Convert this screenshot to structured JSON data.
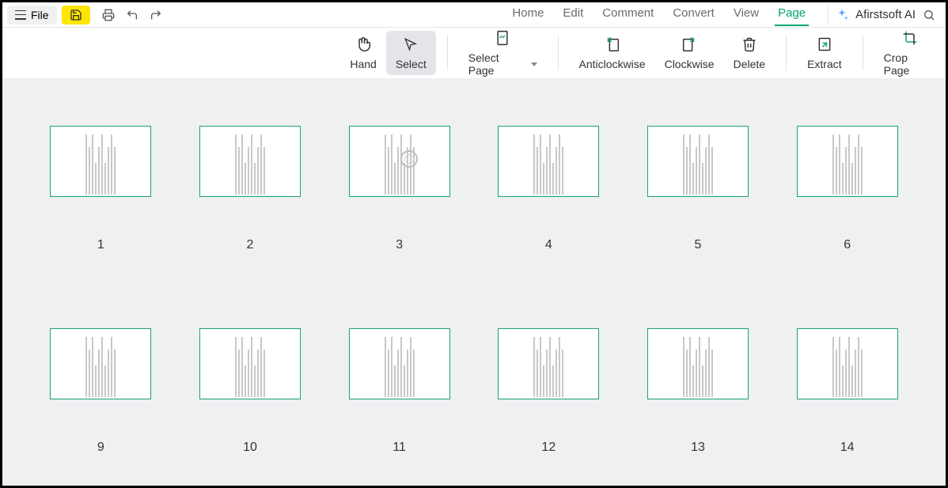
{
  "topbar": {
    "file_label": "File",
    "tabs": [
      {
        "label": "Home",
        "active": false
      },
      {
        "label": "Edit",
        "active": false
      },
      {
        "label": "Comment",
        "active": false
      },
      {
        "label": "Convert",
        "active": false
      },
      {
        "label": "View",
        "active": false
      },
      {
        "label": "Page",
        "active": true
      }
    ],
    "ai_label": "Afirstsoft AI"
  },
  "toolbar": {
    "hand": "Hand",
    "select": "Select",
    "select_page": "Select Page",
    "anticlockwise": "Anticlockwise",
    "clockwise": "Clockwise",
    "delete": "Delete",
    "extract": "Extract",
    "crop_page": "Crop Page",
    "selected": "select"
  },
  "pages": [
    {
      "number": "1"
    },
    {
      "number": "2"
    },
    {
      "number": "3"
    },
    {
      "number": "4"
    },
    {
      "number": "5"
    },
    {
      "number": "6"
    },
    {
      "number": "9"
    },
    {
      "number": "10"
    },
    {
      "number": "11"
    },
    {
      "number": "12"
    },
    {
      "number": "13"
    },
    {
      "number": "14"
    }
  ]
}
